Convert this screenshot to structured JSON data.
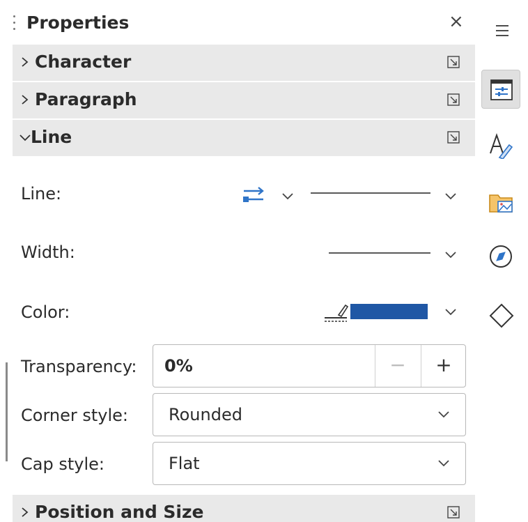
{
  "panel": {
    "title": "Properties",
    "close_symbol": "×"
  },
  "sections": {
    "character": "Character",
    "paragraph": "Paragraph",
    "line": "Line",
    "position": "Position and Size"
  },
  "line_section": {
    "line_label": "Line:",
    "width_label": "Width:",
    "color_label": "Color:",
    "transparency_label": "Transparency:",
    "transparency_value": "0%",
    "minus_symbol": "−",
    "plus_symbol": "+",
    "corner_label": "Corner style:",
    "corner_value": "Rounded",
    "cap_label": "Cap style:",
    "cap_value": "Flat",
    "color_swatch": "#1f57a5"
  },
  "rail": {
    "menu_icon": "menu-icon",
    "items": [
      "properties-icon",
      "styles-icon",
      "gallery-icon",
      "navigator-icon",
      "shapes-icon"
    ]
  }
}
